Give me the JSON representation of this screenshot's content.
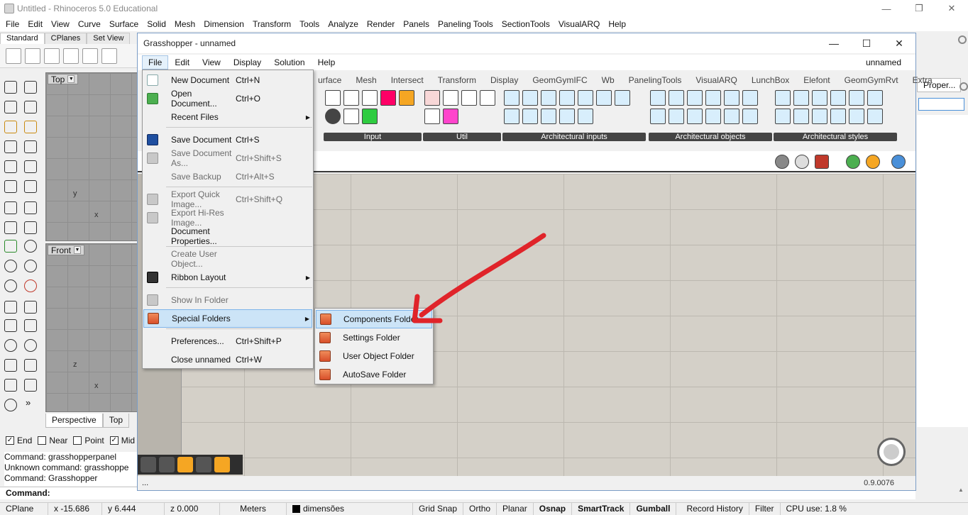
{
  "rhino": {
    "title": "Untitled - Rhinoceros 5.0 Educational",
    "menu": [
      "File",
      "Edit",
      "View",
      "Curve",
      "Surface",
      "Solid",
      "Mesh",
      "Dimension",
      "Transform",
      "Tools",
      "Analyze",
      "Render",
      "Panels",
      "Paneling Tools",
      "SectionTools",
      "VisualARQ",
      "Help"
    ],
    "toolbar_tabs": [
      "Standard",
      "CPlanes",
      "Set View"
    ],
    "viewports": {
      "top_label": "Top",
      "front_label": "Front",
      "axis_x": "x",
      "axis_y": "y",
      "axis_z": "z"
    },
    "viewport_tabs": [
      "Perspective",
      "Top"
    ],
    "osnap": [
      {
        "label": "End",
        "checked": true
      },
      {
        "label": "Near",
        "checked": false
      },
      {
        "label": "Point",
        "checked": false
      },
      {
        "label": "Mid",
        "checked": true
      }
    ],
    "command_history": [
      "Command: grasshopperpanel",
      "Unknown command: grasshoppe",
      "Command: Grasshopper"
    ],
    "command_prompt": "Command:",
    "properties_tab": "Proper...",
    "status": {
      "cplane": "CPlane",
      "x": "x -15.686",
      "y": "y 6.444",
      "z": "z 0.000",
      "units": "Meters",
      "layer": "dimensões",
      "grid_snap": "Grid Snap",
      "ortho": "Ortho",
      "planar": "Planar",
      "osnap": "Osnap",
      "smarttrack": "SmartTrack",
      "gumball": "Gumball",
      "record_history": "Record History",
      "filter": "Filter",
      "cpu": "CPU use: 1.8 %"
    }
  },
  "grasshopper": {
    "title": "Grasshopper - unnamed",
    "document_name": "unnamed",
    "menu": [
      "File",
      "Edit",
      "View",
      "Display",
      "Solution",
      "Help"
    ],
    "component_tabs": [
      "urface",
      "Mesh",
      "Intersect",
      "Transform",
      "Display",
      "GeomGymIFC",
      "Wb",
      "PanelingTools",
      "VisualARQ",
      "LunchBox",
      "Elefont",
      "GeomGymRvt",
      "Extra"
    ],
    "ribbon_groups": [
      "Input",
      "Util",
      "Architectural inputs",
      "Architectural objects",
      "Architectural styles"
    ],
    "status_left": "...",
    "version": "0.9.0076"
  },
  "file_menu": {
    "items": [
      {
        "label": "New Document",
        "shortcut": "Ctrl+N",
        "icon": "new-document-icon",
        "disabled": false
      },
      {
        "label": "Open Document...",
        "shortcut": "Ctrl+O",
        "icon": "open-document-icon",
        "disabled": false
      },
      {
        "label": "Recent Files",
        "shortcut": "",
        "icon": "",
        "disabled": false,
        "submenu": true
      },
      {
        "label": "Save Document",
        "shortcut": "Ctrl+S",
        "icon": "save-icon",
        "disabled": false
      },
      {
        "label": "Save Document As...",
        "shortcut": "Ctrl+Shift+S",
        "icon": "save-as-icon",
        "disabled": true
      },
      {
        "label": "Save Backup",
        "shortcut": "Ctrl+Alt+S",
        "icon": "",
        "disabled": true
      },
      {
        "label": "Export Quick Image...",
        "shortcut": "Ctrl+Shift+Q",
        "icon": "quick-image-icon",
        "disabled": true
      },
      {
        "label": "Export Hi-Res Image...",
        "shortcut": "",
        "icon": "hires-image-icon",
        "disabled": true
      },
      {
        "label": "Document Properties...",
        "shortcut": "",
        "icon": "",
        "disabled": false
      },
      {
        "label": "Create User Object...",
        "shortcut": "",
        "icon": "",
        "disabled": true
      },
      {
        "label": "Ribbon Layout",
        "shortcut": "",
        "icon": "ribbon-layout-icon",
        "disabled": false,
        "submenu": true
      },
      {
        "label": "Show In Folder",
        "shortcut": "",
        "icon": "show-folder-icon",
        "disabled": true
      },
      {
        "label": "Special Folders",
        "shortcut": "",
        "icon": "special-folders-icon",
        "disabled": false,
        "submenu": true,
        "highlighted": true
      },
      {
        "label": "Preferences...",
        "shortcut": "Ctrl+Shift+P",
        "icon": "",
        "disabled": false
      },
      {
        "label": "Close unnamed",
        "shortcut": "Ctrl+W",
        "icon": "",
        "disabled": false
      }
    ]
  },
  "special_folders_submenu": {
    "items": [
      {
        "label": "Components Folder",
        "highlighted": true
      },
      {
        "label": "Settings Folder",
        "highlighted": false
      },
      {
        "label": "User Object Folder",
        "highlighted": false
      },
      {
        "label": "AutoSave Folder",
        "highlighted": false
      }
    ]
  },
  "colors": {
    "accent_highlight": "#cce4f7",
    "annotation_arrow": "#e0242a",
    "folder_icon": "#d84f2a"
  }
}
